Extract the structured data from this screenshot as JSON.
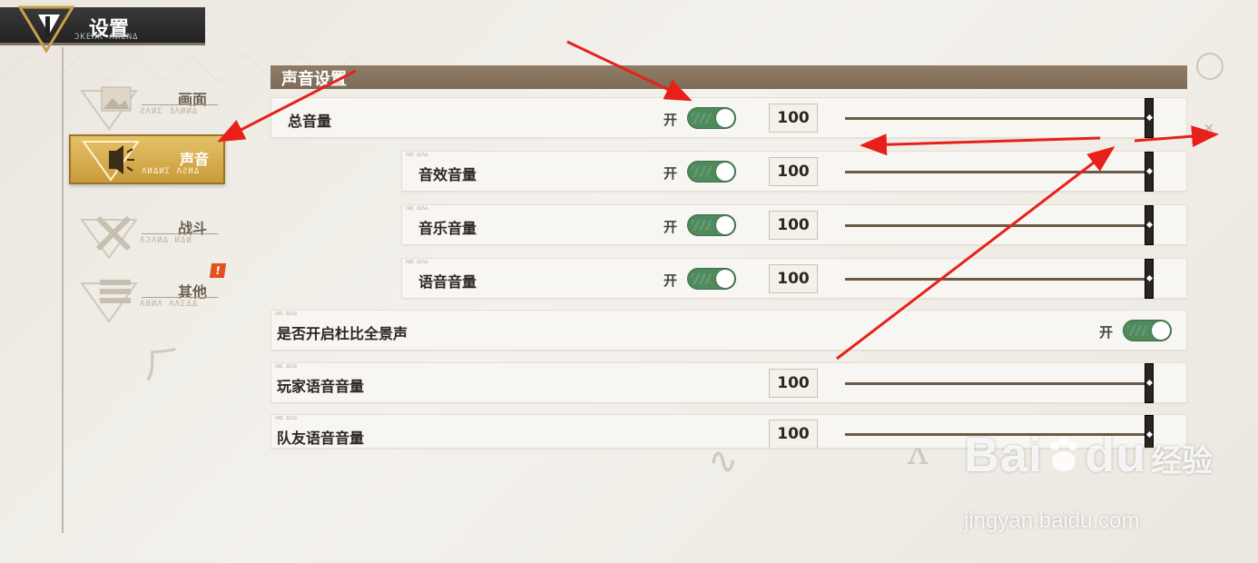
{
  "header": {
    "title": "设置",
    "subtitle": "ƆKEHK ΛИΣNΔ"
  },
  "sidebar": {
    "items": [
      {
        "label": "画面",
        "sub": "ƧΛИΣ ƎΛИИΔ",
        "icon": "picture-icon",
        "active": false
      },
      {
        "label": "声音",
        "sub": "ΛИΔИΣ ΛƧИΔ",
        "icon": "speaker-icon",
        "active": true
      },
      {
        "label": "战斗",
        "sub": "ΛƆΛИΔ ИΔИ",
        "icon": "swords-icon",
        "active": false
      },
      {
        "label": "其他",
        "sub": "ΛΘИΛ ΛΛΣΔΔ",
        "icon": "list-icon",
        "active": false,
        "badge": "!"
      }
    ]
  },
  "section": {
    "title": "声音设置"
  },
  "rows": {
    "master": {
      "label": "总音量",
      "toggle": "开",
      "value": "100"
    },
    "sfx": {
      "label": "音效音量",
      "toggle": "开",
      "value": "100"
    },
    "music": {
      "label": "音乐音量",
      "toggle": "开",
      "value": "100"
    },
    "voice": {
      "label": "语音音量",
      "toggle": "开",
      "value": "100"
    },
    "dolby": {
      "label": "是否开启杜比全景声",
      "toggle": "开"
    },
    "player_voice": {
      "label": "玩家语音音量",
      "value": "100"
    },
    "team_voice": {
      "label": "队友语音音量",
      "value": "100"
    }
  },
  "levels": {
    "master": 1.0,
    "sfx": 1.0,
    "music": 1.0,
    "voice": 1.0,
    "player_voice": 1.0,
    "team_voice": 1.0
  },
  "watermark": {
    "brand": "Bai",
    "brand2": "du",
    "cn": "经验",
    "url": "jingyan.baidu.com"
  },
  "colors": {
    "accent_gold": "#d9ac4b",
    "toggle_green": "#4e8a5c",
    "section_brown": "#8a7763",
    "arrow_red": "#e8201a"
  }
}
